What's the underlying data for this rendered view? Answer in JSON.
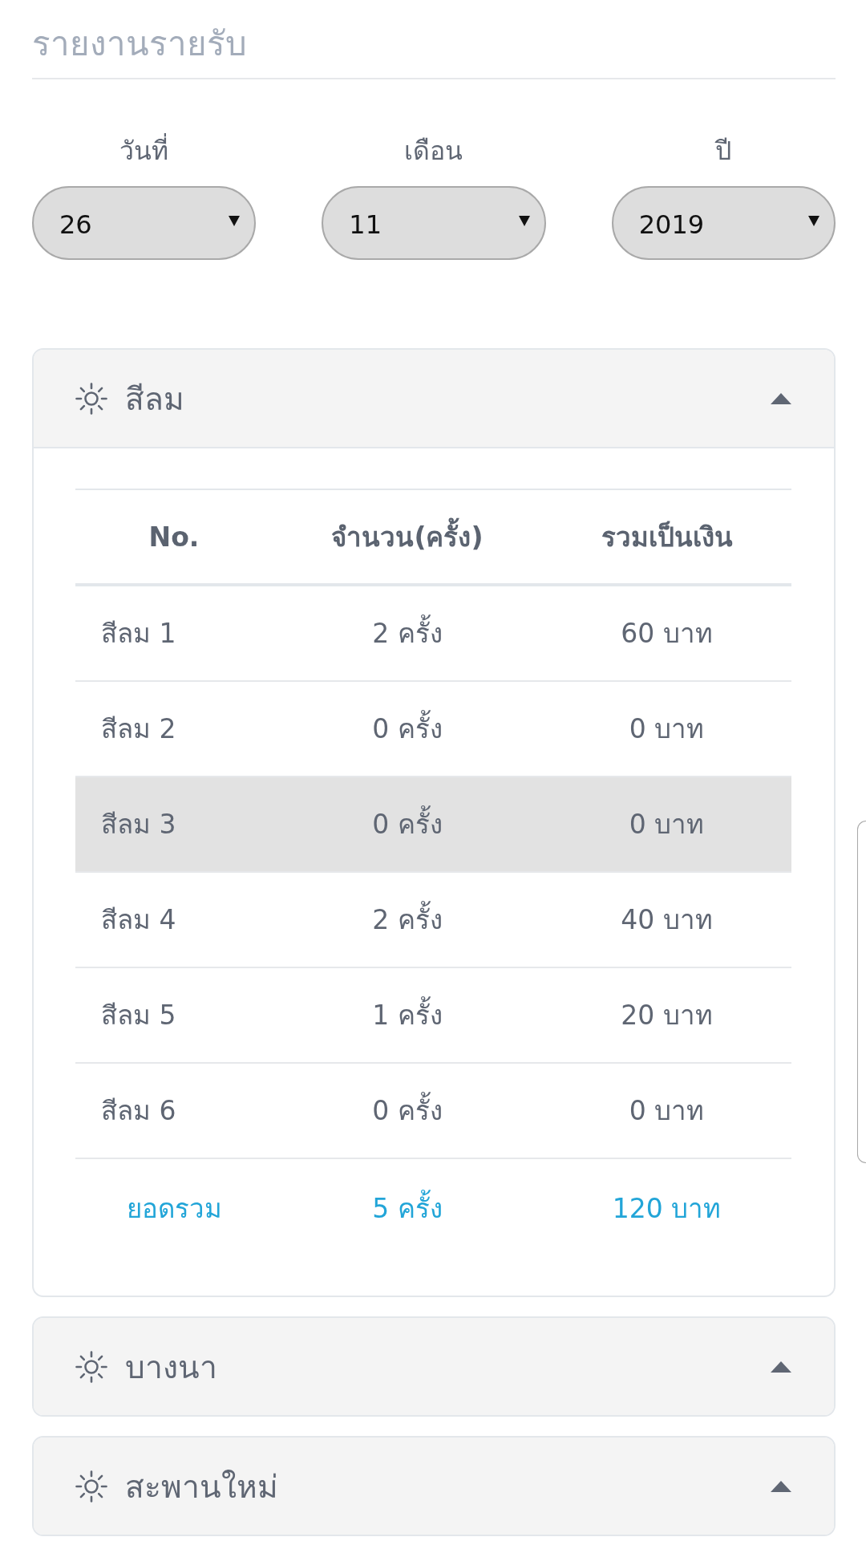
{
  "page": {
    "title": "รายงานรายรับ"
  },
  "date_filter": [
    {
      "label": "วันที่",
      "value": "26"
    },
    {
      "label": "เดือน",
      "value": "11"
    },
    {
      "label": "ปี",
      "value": "2019"
    }
  ],
  "branches": [
    {
      "name": "สีลม",
      "expanded": true,
      "table": {
        "columns": [
          "No.",
          "จำนวน(ครั้ง)",
          "รวมเป็นเงิน"
        ],
        "rows": [
          {
            "cells": [
              "สีลม 1",
              "2 ครั้ง",
              "60 บาท"
            ],
            "highlighted": false
          },
          {
            "cells": [
              "สีลม 2",
              "0 ครั้ง",
              "0 บาท"
            ],
            "highlighted": false
          },
          {
            "cells": [
              "สีลม 3",
              "0 ครั้ง",
              "0 บาท"
            ],
            "highlighted": true
          },
          {
            "cells": [
              "สีลม 4",
              "2 ครั้ง",
              "40 บาท"
            ],
            "highlighted": false
          },
          {
            "cells": [
              "สีลม 5",
              "1 ครั้ง",
              "20 บาท"
            ],
            "highlighted": false
          },
          {
            "cells": [
              "สีลม 6",
              "0 ครั้ง",
              "0 บาท"
            ],
            "highlighted": false
          }
        ],
        "total": [
          "ยอดรวม",
          "5 ครั้ง",
          "120 บาท"
        ]
      }
    },
    {
      "name": "บางนา",
      "expanded": false
    },
    {
      "name": "สะพานใหม่",
      "expanded": false
    }
  ]
}
